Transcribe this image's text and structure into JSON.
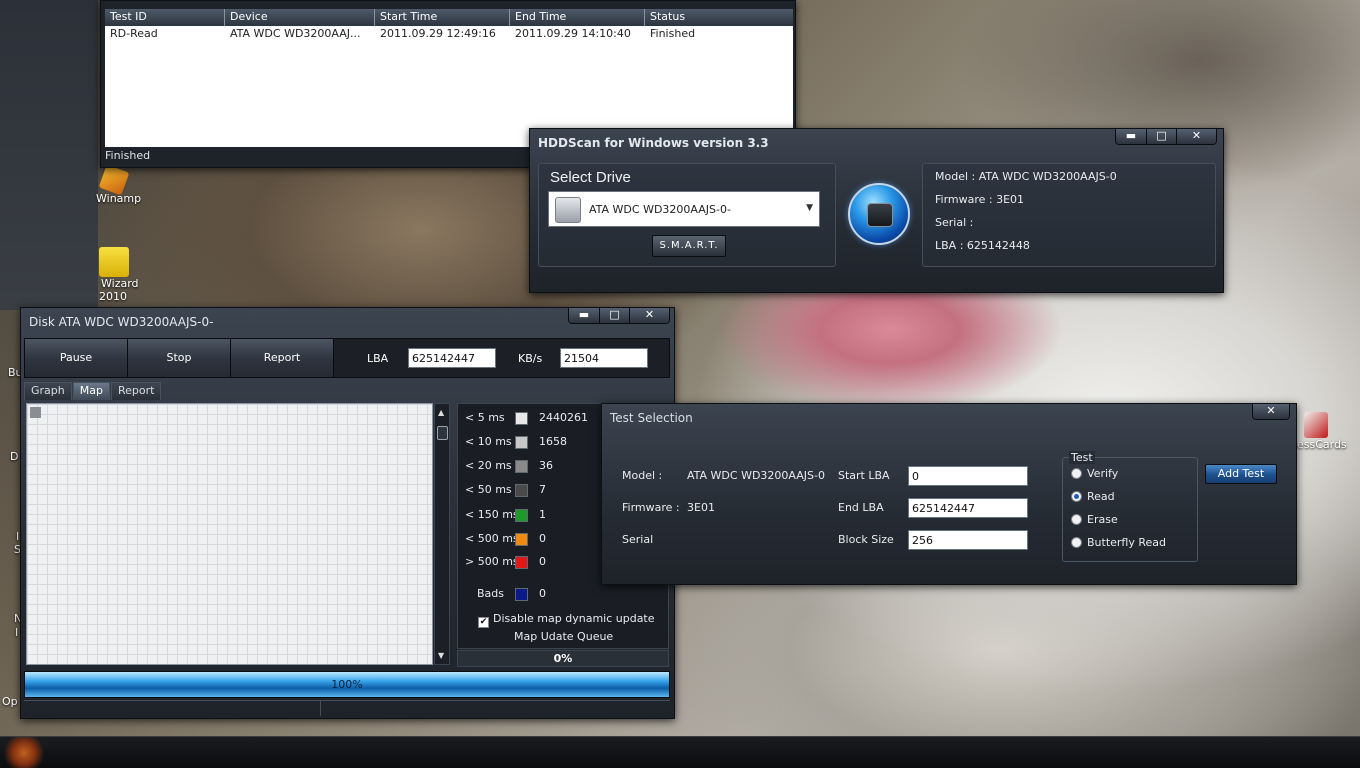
{
  "desktop": {
    "icons": [
      {
        "label": "Winamp",
        "color": "#e89a10"
      },
      {
        "label": "Wizard",
        "sublabel": "2010",
        "color": "#f2d40c"
      },
      {
        "label": "nessCards",
        "color": "#c82020"
      }
    ],
    "side_fragments": [
      "Bu",
      "D",
      "I",
      "S",
      "N",
      "I",
      "Op"
    ]
  },
  "test_list": {
    "columns": [
      "Test ID",
      "Device",
      "Start Time",
      "End Time",
      "Status"
    ],
    "rows": [
      {
        "test_id": "RD-Read",
        "device": "ATA    WDC WD3200AAJ...",
        "start": "2011.09.29 12:49:16",
        "end": "2011.09.29 14:10:40",
        "status": "Finished"
      }
    ],
    "status": "Finished"
  },
  "main_window": {
    "title": "HDDScan for Windows version 3.3",
    "select_drive_label": "Select Drive",
    "selected_drive": "ATA      WDC WD3200AAJS-0-",
    "smart_button": "S.M.A.R.T.",
    "model": "Model : ATA     WDC WD3200AAJS-0",
    "firmware": "Firmware : 3E01",
    "serial": "Serial :",
    "lba": "LBA : 625142448"
  },
  "disk_window": {
    "title": "Disk ATA      WDC WD3200AAJS-0-",
    "buttons": {
      "pause": "Pause",
      "stop": "Stop",
      "report": "Report"
    },
    "lba_label": "LBA",
    "lba_value": "625142447",
    "kbs_label": "KB/s",
    "kbs_value": "21504",
    "tabs": [
      "Graph",
      "Map",
      "Report"
    ],
    "active_tab": "Map",
    "legend": [
      {
        "label": "< 5 ms",
        "color": "#e8e8e8",
        "value": "2440261"
      },
      {
        "label": "< 10 ms",
        "color": "#c8c8c8",
        "value": "1658"
      },
      {
        "label": "< 20 ms",
        "color": "#8a8a8a",
        "value": "36"
      },
      {
        "label": "< 50 ms",
        "color": "#4a4a4a",
        "value": "7"
      },
      {
        "label": "< 150 ms",
        "color": "#1f9a2a",
        "value": "1"
      },
      {
        "label": "< 500 ms",
        "color": "#f08a10",
        "value": "0"
      },
      {
        "label": "> 500 ms",
        "color": "#e01818",
        "value": "0"
      },
      {
        "label": "Bads",
        "color": "#0a1a8a",
        "value": "0"
      }
    ],
    "disable_map_label": "Disable map dynamic update",
    "disable_map_checked": true,
    "queue_label": "Map Udate Queue",
    "queue_value": "0%",
    "progress_fraction": 1.0,
    "progress_text": "100%"
  },
  "test_selection": {
    "title": "Test Selection",
    "model_label": "Model :",
    "model_value": "ATA      WDC WD3200AAJS-0",
    "firmware_label": "Firmware :",
    "firmware_value": "3E01",
    "serial_label": "Serial",
    "start_lba_label": "Start LBA",
    "start_lba_value": "0",
    "end_lba_label": "End LBA",
    "end_lba_value": "625142447",
    "block_size_label": "Block Size",
    "block_size_value": "256",
    "group_title": "Test",
    "options": [
      "Verify",
      "Read",
      "Erase",
      "Butterfly Read"
    ],
    "selected_option": "Read",
    "add_test_button": "Add Test"
  },
  "window_controls": {
    "minimize": "▬",
    "maximize": "□",
    "close": "✕"
  }
}
